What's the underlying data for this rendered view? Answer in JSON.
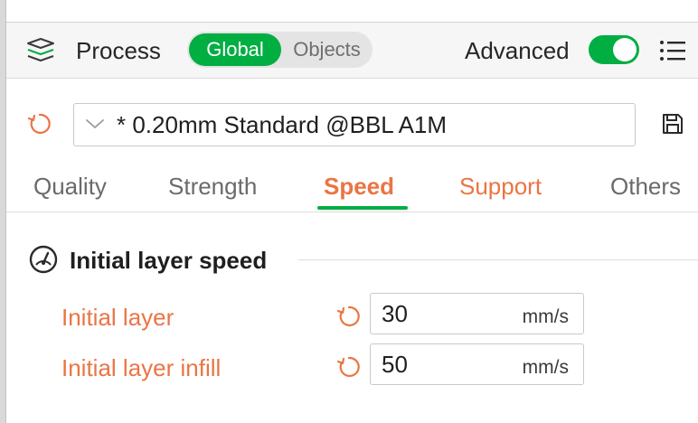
{
  "colors": {
    "accent_green": "#00ae42",
    "modified_orange": "#ea7544",
    "header_bg": "#f6f6f6"
  },
  "header": {
    "title": "Process",
    "title_icon": "layers-icon",
    "mode_toggle": {
      "options": [
        "Global",
        "Objects"
      ],
      "selected": "Global"
    },
    "advanced_label": "Advanced",
    "advanced_enabled": true,
    "menu_icon": "list-icon"
  },
  "preset": {
    "reset_icon": "reset-arrow-icon",
    "value": "* 0.20mm Standard @BBL A1M",
    "save_icon": "save-icon"
  },
  "tabs": [
    {
      "label": "Quality",
      "state": "normal"
    },
    {
      "label": "Strength",
      "state": "normal"
    },
    {
      "label": "Speed",
      "state": "active"
    },
    {
      "label": "Support",
      "state": "modified"
    },
    {
      "label": "Others",
      "state": "normal"
    }
  ],
  "section": {
    "icon": "speedometer-icon",
    "title": "Initial layer speed",
    "params": [
      {
        "label": "Initial layer",
        "value": "30",
        "unit": "mm/s"
      },
      {
        "label": "Initial layer infill",
        "value": "50",
        "unit": "mm/s"
      }
    ]
  }
}
